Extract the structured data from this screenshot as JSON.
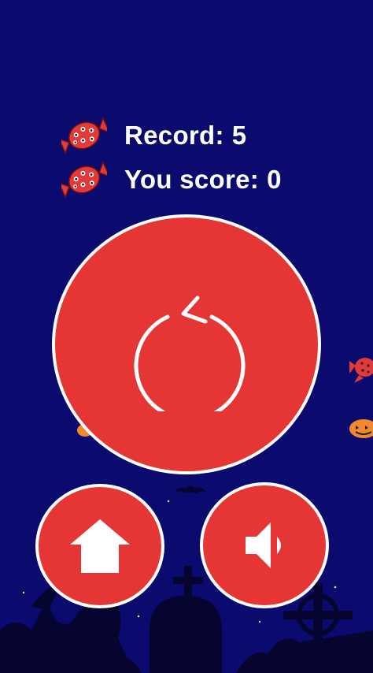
{
  "scores": {
    "record_label": "Record:",
    "record_value": "5",
    "current_label": "You score:",
    "current_value": "0"
  },
  "buttons": {
    "restart": "restart-icon",
    "home": "home-icon",
    "sound": "speaker-icon"
  },
  "colors": {
    "background": "#0b0a6e",
    "button": "#e63535",
    "button_border": "#ffffff",
    "text": "#ffffff",
    "candy": "#e23a3a"
  }
}
